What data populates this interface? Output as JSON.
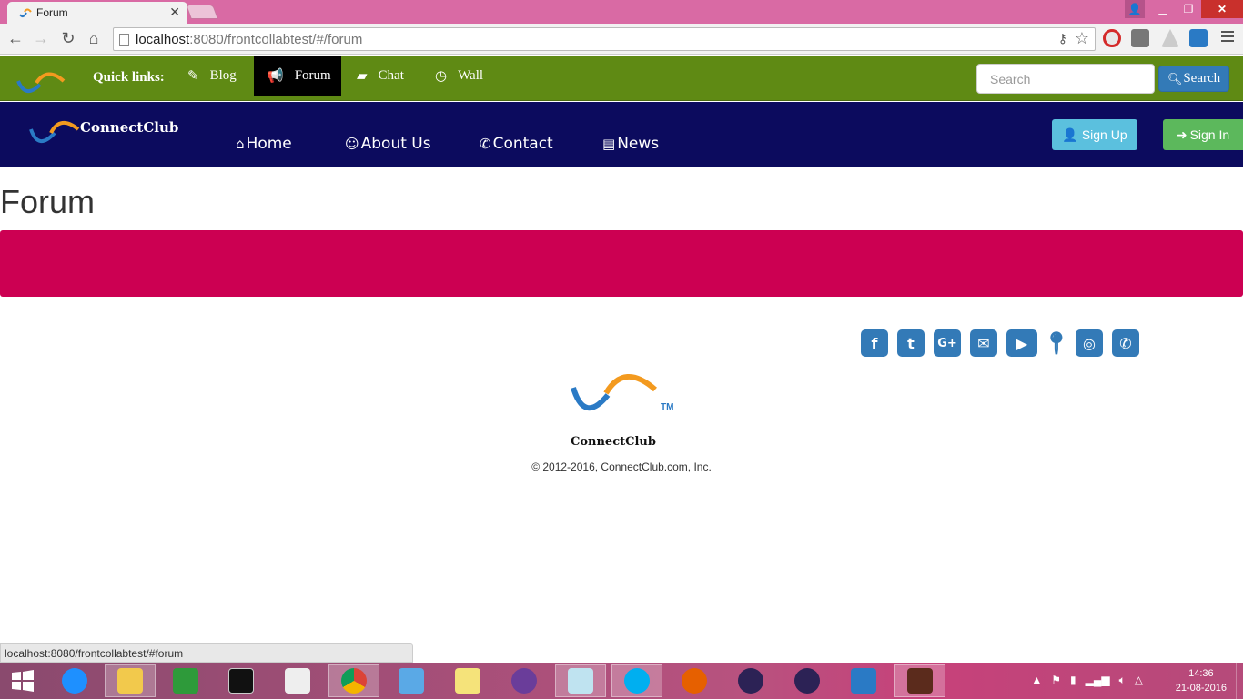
{
  "browser": {
    "tab_title": "Forum",
    "url_host": "localhost",
    "url_rest": ":8080/frontcollabtest/#/forum",
    "status_url": "localhost:8080/frontcollabtest/#forum"
  },
  "quicklinks": {
    "label": "Quick links:",
    "items": [
      {
        "label": "Blog",
        "icon": "pencil-icon"
      },
      {
        "label": "Forum",
        "icon": "bullhorn-icon"
      },
      {
        "label": "Chat",
        "icon": "comment-icon"
      },
      {
        "label": "Wall",
        "icon": "dashboard-icon"
      }
    ],
    "search_placeholder": "Search",
    "search_button": "Search"
  },
  "nav": {
    "brand": "ConnectClub",
    "links": [
      "Home",
      "About Us",
      "Contact",
      "News"
    ],
    "signup": "Sign Up",
    "signin": "Sign In"
  },
  "page": {
    "heading": "Forum",
    "banner_color": "#cc0052"
  },
  "footer": {
    "social": [
      "facebook-icon",
      "twitter-icon",
      "google-plus-icon",
      "envelope-icon",
      "youtube-icon",
      "map-marker-icon",
      "instagram-icon",
      "phone-icon"
    ],
    "tm": "TM",
    "brand": "ConnectClub",
    "copyright": "© 2012-2016, ConnectClub.com, Inc."
  },
  "taskbar": {
    "time": "14:36",
    "date": "21-08-2016"
  },
  "colors": {
    "quickbar": "#5f8a14",
    "navbar": "#0c0b5e",
    "signup": "#5bc0de",
    "signin": "#5cb85c",
    "social": "#337ab7"
  }
}
